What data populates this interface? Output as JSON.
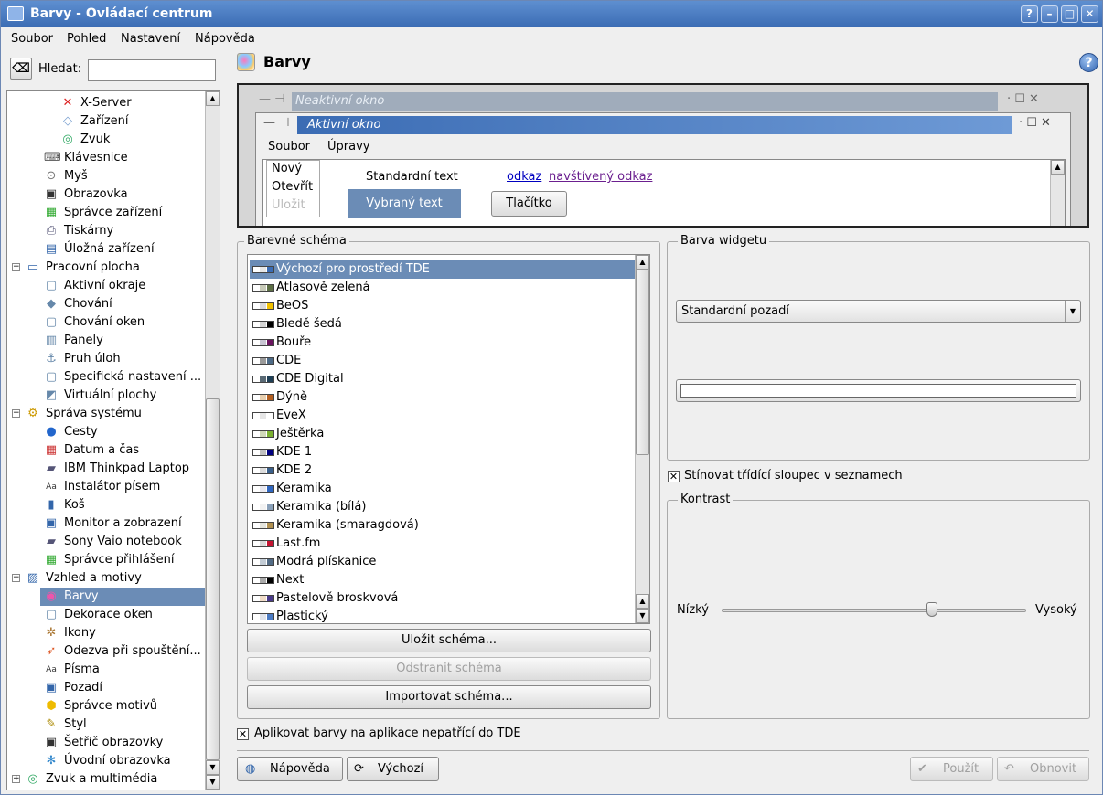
{
  "window": {
    "title": "Barvy - Ovládací centrum",
    "buttons": {
      "help": "?",
      "minimize": "–",
      "maximize": "□",
      "close": "✕"
    }
  },
  "menubar": [
    "Soubor",
    "Pohled",
    "Nastavení",
    "Nápověda"
  ],
  "search": {
    "label": "Hledat:",
    "value": ""
  },
  "tree": [
    {
      "label": "X-Server",
      "icon": "x-server-icon",
      "glyph": "✕",
      "color": "#d22"
    },
    {
      "label": "Zařízení",
      "icon": "devices-icon",
      "glyph": "◇",
      "color": "#7aa0d0"
    },
    {
      "label": "Zvuk",
      "icon": "sound-icon",
      "glyph": "◎",
      "color": "#3a6"
    },
    {
      "label": "Klávesnice",
      "icon": "keyboard-icon",
      "glyph": "⌨",
      "color": "#555"
    },
    {
      "label": "Myš",
      "icon": "mouse-icon",
      "glyph": "⊙",
      "color": "#777"
    },
    {
      "label": "Obrazovka",
      "icon": "screen-icon",
      "glyph": "▣",
      "color": "#333"
    },
    {
      "label": "Správce zařízení",
      "icon": "device-manager-icon",
      "glyph": "▦",
      "color": "#3a3"
    },
    {
      "label": "Tiskárny",
      "icon": "printer-icon",
      "glyph": "⎙",
      "color": "#557"
    },
    {
      "label": "Úložná zařízení",
      "icon": "storage-icon",
      "glyph": "▤",
      "color": "#36a"
    },
    {
      "label": "Pracovní plocha",
      "icon": "desktop-icon",
      "glyph": "▭",
      "color": "#36a",
      "expander": "−"
    },
    {
      "label": "Aktivní okraje",
      "icon": "window-icon",
      "glyph": "▢",
      "color": "#68a"
    },
    {
      "label": "Chování",
      "icon": "behavior-icon",
      "glyph": "◆",
      "color": "#68a"
    },
    {
      "label": "Chování oken",
      "icon": "window-behavior-icon",
      "glyph": "▢",
      "color": "#68a"
    },
    {
      "label": "Panely",
      "icon": "panels-icon",
      "glyph": "▥",
      "color": "#68a"
    },
    {
      "label": "Pruh úloh",
      "icon": "taskbar-icon",
      "glyph": "⚓",
      "color": "#68a"
    },
    {
      "label": "Specifická nastavení ...",
      "icon": "window-specific-icon",
      "glyph": "▢",
      "color": "#68a"
    },
    {
      "label": "Virtuální plochy",
      "icon": "virtual-desktops-icon",
      "glyph": "◩",
      "color": "#68a"
    },
    {
      "label": "Správa systému",
      "icon": "system-admin-icon",
      "glyph": "⚙",
      "color": "#c90",
      "expander": "−"
    },
    {
      "label": "Cesty",
      "icon": "paths-icon",
      "glyph": "●",
      "color": "#26c"
    },
    {
      "label": "Datum a čas",
      "icon": "date-time-icon",
      "glyph": "▦",
      "color": "#c33"
    },
    {
      "label": "IBM Thinkpad Laptop",
      "icon": "laptop-icon",
      "glyph": "▰",
      "color": "#557"
    },
    {
      "label": "Instalátor písem",
      "icon": "font-installer-icon",
      "glyph": "Aa",
      "color": "#333"
    },
    {
      "label": "Koš",
      "icon": "trash-icon",
      "glyph": "▮",
      "color": "#36a"
    },
    {
      "label": "Monitor a zobrazení",
      "icon": "monitor-icon",
      "glyph": "▣",
      "color": "#36a"
    },
    {
      "label": "Sony Vaio notebook",
      "icon": "notebook-icon",
      "glyph": "▰",
      "color": "#557"
    },
    {
      "label": "Správce přihlášení",
      "icon": "login-manager-icon",
      "glyph": "▦",
      "color": "#3a3"
    },
    {
      "label": "Vzhled a motivy",
      "icon": "appearance-icon",
      "glyph": "▨",
      "color": "#36a",
      "expander": "−"
    },
    {
      "label": "Barvy",
      "icon": "colors-icon",
      "glyph": "◉",
      "color": "#e5a",
      "selected": true
    },
    {
      "label": "Dekorace oken",
      "icon": "window-decoration-icon",
      "glyph": "▢",
      "color": "#68a"
    },
    {
      "label": "Ikony",
      "icon": "icons-icon",
      "glyph": "✲",
      "color": "#a73"
    },
    {
      "label": "Odezva při spouštění...",
      "icon": "launch-feedback-icon",
      "glyph": "➶",
      "color": "#d52"
    },
    {
      "label": "Písma",
      "icon": "fonts-icon",
      "glyph": "Aa",
      "color": "#333"
    },
    {
      "label": "Pozadí",
      "icon": "background-icon",
      "glyph": "▣",
      "color": "#36a"
    },
    {
      "label": "Správce motivů",
      "icon": "theme-manager-icon",
      "glyph": "⬢",
      "color": "#eb0"
    },
    {
      "label": "Styl",
      "icon": "style-icon",
      "glyph": "✎",
      "color": "#a80"
    },
    {
      "label": "Šetřič obrazovky",
      "icon": "screensaver-icon",
      "glyph": "▣",
      "color": "#333"
    },
    {
      "label": "Úvodní obrazovka",
      "icon": "splash-icon",
      "glyph": "✻",
      "color": "#38c"
    },
    {
      "label": "Zvuk a multimédia",
      "icon": "multimedia-icon",
      "glyph": "◎",
      "color": "#3a6",
      "expander": "+"
    }
  ],
  "header": {
    "title": "Barvy"
  },
  "preview": {
    "inactive_title": "Neaktivní okno",
    "active_title": "Aktivní okno",
    "menu": [
      "Soubor",
      "Úpravy"
    ],
    "list": [
      "Nový",
      "Otevřít",
      "Uložit"
    ],
    "standard_text": "Standardní text",
    "selected_text": "Vybraný text",
    "link": "odkaz",
    "visited_link": "navštívený odkaz",
    "button": "Tlačítko"
  },
  "schemes": {
    "group_label": "Barevné schéma",
    "items": [
      {
        "name": "Výchozí pro prostředí TDE",
        "c": [
          "#e6e6e6",
          "#3b6cb4"
        ],
        "selected": true
      },
      {
        "name": "Atlasově zelená",
        "c": [
          "#c8cbb9",
          "#5d6f45"
        ]
      },
      {
        "name": "BeOS",
        "c": [
          "#d9d9d9",
          "#f0c000"
        ]
      },
      {
        "name": "Bledě šedá",
        "c": [
          "#d4d4d4",
          "#000000"
        ]
      },
      {
        "name": "Bouře",
        "c": [
          "#c9c6d3",
          "#6a145f"
        ]
      },
      {
        "name": "CDE",
        "c": [
          "#9a9a9a",
          "#4d6a86"
        ]
      },
      {
        "name": "CDE Digital",
        "c": [
          "#5a6a75",
          "#1f3f55"
        ]
      },
      {
        "name": "Dýně",
        "c": [
          "#e8cfae",
          "#b45f20"
        ]
      },
      {
        "name": "EveX",
        "c": [
          "#e6e6e6",
          "#ffffff"
        ]
      },
      {
        "name": "Ještěrka",
        "c": [
          "#d0d8b8",
          "#7ab030"
        ]
      },
      {
        "name": "KDE 1",
        "c": [
          "#c0c0c0",
          "#000080"
        ]
      },
      {
        "name": "KDE 2",
        "c": [
          "#dcdcdc",
          "#3a5f8a"
        ]
      },
      {
        "name": "Keramika",
        "c": [
          "#e8e8f0",
          "#2f66c0"
        ]
      },
      {
        "name": "Keramika (bílá)",
        "c": [
          "#f2f2f2",
          "#8aa0b8"
        ]
      },
      {
        "name": "Keramika (smaragdová)",
        "c": [
          "#e4e4dc",
          "#b09050"
        ]
      },
      {
        "name": "Last.fm",
        "c": [
          "#d8d8d8",
          "#c41230"
        ]
      },
      {
        "name": "Modrá plískanice",
        "c": [
          "#c3ccd5",
          "#526b85"
        ]
      },
      {
        "name": "Next",
        "c": [
          "#aaaaaa",
          "#000000"
        ]
      },
      {
        "name": "Pastelově broskvová",
        "c": [
          "#f0dcc8",
          "#4a3a8a"
        ]
      },
      {
        "name": "Plastický",
        "c": [
          "#e0e4ec",
          "#4b7bc4"
        ]
      }
    ]
  },
  "scheme_buttons": {
    "save": "Uložit schéma...",
    "remove": "Odstranit schéma",
    "import": "Importovat schéma..."
  },
  "widget_color": {
    "group_label": "Barva widgetu",
    "selected": "Standardní pozadí",
    "swatch": "#ffffff"
  },
  "shade_sorted": {
    "label": "Stínovat třídící sloupec v seznamech",
    "checked": true
  },
  "contrast": {
    "group_label": "Kontrast",
    "low": "Nízký",
    "high": "Vysoký",
    "value": 0.7
  },
  "apply_colors": {
    "label": "Aplikovat barvy na aplikace nepatřící do TDE",
    "checked": true
  },
  "footer": {
    "help": "Nápověda",
    "defaults": "Výchozí",
    "apply": "Použít",
    "reset": "Obnovit"
  },
  "colors": {
    "selection": "#6b8cb6",
    "titlebar": "#3b6cb4",
    "inactive_title": "#a0acbb",
    "link": "#0000c0",
    "visited": "#6b1f8f"
  }
}
